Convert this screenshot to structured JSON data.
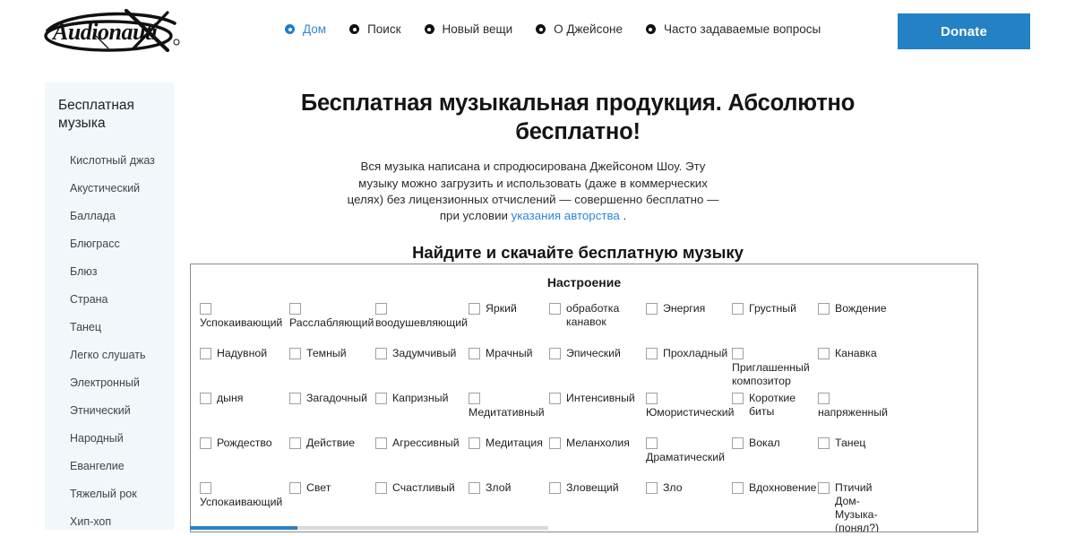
{
  "header": {
    "logo_text": "Audionautix",
    "logo_icon": "audionautix-logo",
    "nav": [
      {
        "label": "Дом",
        "active": true
      },
      {
        "label": "Поиск",
        "active": false
      },
      {
        "label": "Новый вещи",
        "active": false
      },
      {
        "label": "О Джейсоне",
        "active": false
      },
      {
        "label": "Часто задаваемые вопросы",
        "active": false
      }
    ],
    "donate_label": "Donate",
    "donate_color": "#2481c4"
  },
  "sidebar": {
    "title": "Бесплатная музыка",
    "background": "#f2f7fb",
    "items": [
      {
        "label": "Кислотный джаз"
      },
      {
        "label": "Акустический"
      },
      {
        "label": "Баллада"
      },
      {
        "label": "Блюграсс"
      },
      {
        "label": "Блюз"
      },
      {
        "label": "Страна"
      },
      {
        "label": "Танец"
      },
      {
        "label": "Легко слушать"
      },
      {
        "label": "Электронный"
      },
      {
        "label": "Этнический"
      },
      {
        "label": "Народный"
      },
      {
        "label": "Евангелие"
      },
      {
        "label": "Тяжелый рок"
      },
      {
        "label": "Хип-хоп"
      }
    ]
  },
  "main": {
    "title": "Бесплатная музыкальная продукция. Абсолютно бесплатно!",
    "intro_before": "Вся музыка написана и спродюсирована Джейсоном Шоу. Эту музыку можно загрузить и использовать (даже в коммерческих целях) без лицензионных отчислений — совершенно бесплатно — при условии ",
    "intro_link": "указания авторства",
    "intro_after": " .",
    "link_color": "#2f86d4",
    "section_title": "Найдите и скачайте бесплатную музыку"
  },
  "mood": {
    "box_title": "Настроение",
    "rows": [
      [
        {
          "label": "Успокаивающий",
          "checked": false,
          "stack": true
        },
        {
          "label": "Расслабляющий",
          "checked": false,
          "stack": true
        },
        {
          "label": "воодушевляющий",
          "checked": false,
          "stack": true
        },
        {
          "label": "Яркий",
          "checked": false,
          "stack": false
        },
        {
          "label": "обработка канавок",
          "checked": false,
          "stack": false
        },
        {
          "label": "Энергия",
          "checked": false,
          "stack": false
        },
        {
          "label": "Грустный",
          "checked": false,
          "stack": false
        },
        {
          "label": "Вождение",
          "checked": false,
          "stack": false
        }
      ],
      [
        {
          "label": "Надувной",
          "checked": false,
          "stack": false
        },
        {
          "label": "Темный",
          "checked": false,
          "stack": false
        },
        {
          "label": "Задумчивый",
          "checked": false,
          "stack": false
        },
        {
          "label": "Мрачный",
          "checked": false,
          "stack": false
        },
        {
          "label": "Эпический",
          "checked": false,
          "stack": false
        },
        {
          "label": "Прохладный",
          "checked": false,
          "stack": false
        },
        {
          "label": "Приглашенный композитор",
          "checked": false,
          "stack": true
        },
        {
          "label": "Канавка",
          "checked": false,
          "stack": false
        }
      ],
      [
        {
          "label": "дыня",
          "checked": false,
          "stack": false
        },
        {
          "label": "Загадочный",
          "checked": false,
          "stack": false
        },
        {
          "label": "Капризный",
          "checked": false,
          "stack": false
        },
        {
          "label": "Медитативный",
          "checked": false,
          "stack": true
        },
        {
          "label": "Интенсивный",
          "checked": false,
          "stack": false
        },
        {
          "label": "Юмористический",
          "checked": false,
          "stack": true
        },
        {
          "label": "Короткие биты",
          "checked": false,
          "stack": false
        },
        {
          "label": "напряженный",
          "checked": false,
          "stack": true
        }
      ],
      [
        {
          "label": "Рождество",
          "checked": false,
          "stack": false
        },
        {
          "label": "Действие",
          "checked": false,
          "stack": false
        },
        {
          "label": "Агрессивный",
          "checked": false,
          "stack": false
        },
        {
          "label": "Медитация",
          "checked": false,
          "stack": false
        },
        {
          "label": "Меланхолия",
          "checked": false,
          "stack": false
        },
        {
          "label": "Драматический",
          "checked": false,
          "stack": true
        },
        {
          "label": "Вокал",
          "checked": false,
          "stack": false
        },
        {
          "label": "Танец",
          "checked": false,
          "stack": false
        }
      ],
      [
        {
          "label": "Успокаивающий",
          "checked": false,
          "stack": true
        },
        {
          "label": "Свет",
          "checked": false,
          "stack": false
        },
        {
          "label": "Счастливый",
          "checked": false,
          "stack": false
        },
        {
          "label": "Злой",
          "checked": false,
          "stack": false
        },
        {
          "label": "Зловещий",
          "checked": false,
          "stack": false
        },
        {
          "label": "Зло",
          "checked": false,
          "stack": false
        },
        {
          "label": "Вдохновение",
          "checked": false,
          "stack": false
        },
        {
          "label": "Птичий Дом-Музыка-(понял?)",
          "checked": false,
          "stack": false
        }
      ]
    ]
  }
}
